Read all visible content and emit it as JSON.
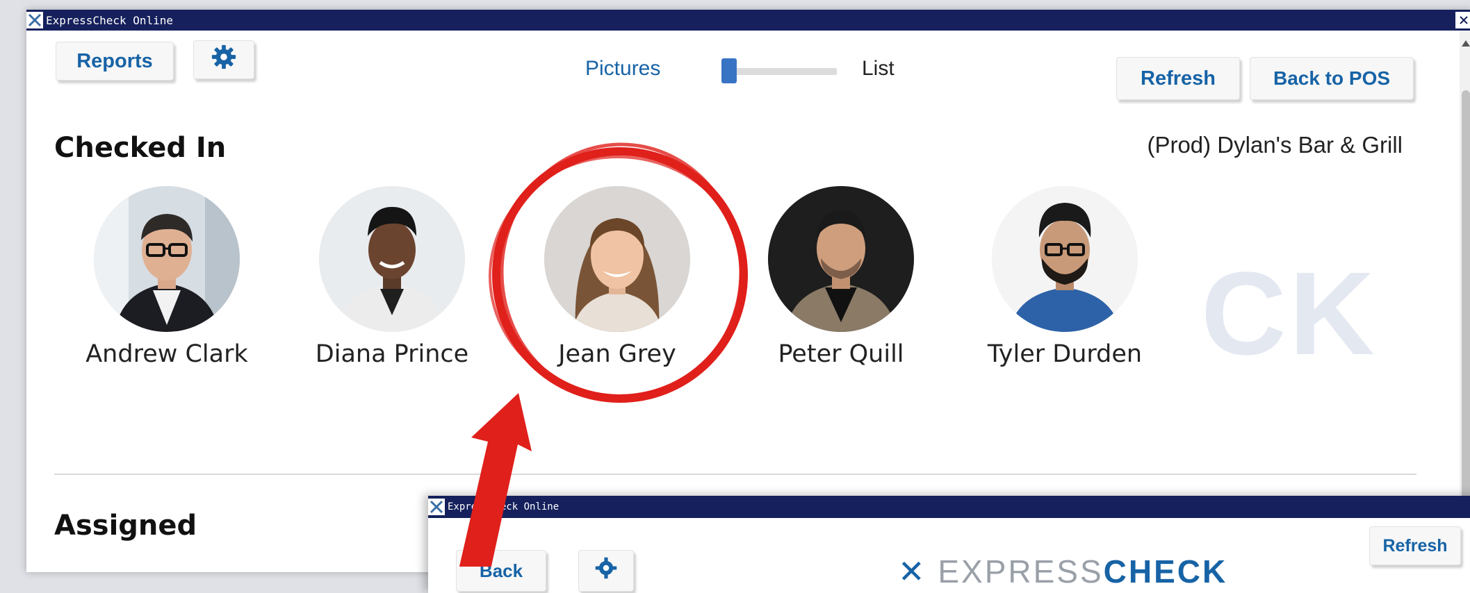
{
  "window": {
    "title": "ExpressCheck Online"
  },
  "toolbar": {
    "reports_label": "Reports",
    "settings_icon": "gear-icon",
    "view_toggle": {
      "left_label": "Pictures",
      "right_label": "List",
      "selected": "Pictures"
    },
    "refresh_label": "Refresh",
    "back_to_pos_label": "Back to POS"
  },
  "venue": "(Prod) Dylan's Bar & Grill",
  "watermark": "CK",
  "sections": {
    "checked_in": {
      "title": "Checked In",
      "people": [
        {
          "name": "Andrew Clark"
        },
        {
          "name": "Diana Prince"
        },
        {
          "name": "Jean Grey"
        },
        {
          "name": "Peter Quill"
        },
        {
          "name": "Tyler Durden"
        }
      ]
    },
    "assigned": {
      "title": "Assigned"
    }
  },
  "annotation": {
    "highlighted": "Jean Grey",
    "color": "#e0201b"
  },
  "overlay_window": {
    "title": "ExpressCheck Online",
    "back_label": "Back",
    "settings_icon": "gear-icon",
    "brand_light": "EXPRESS",
    "brand_bold": "CHECK",
    "refresh_label": "Refresh"
  },
  "colors": {
    "titlebar": "#15205c",
    "accent": "#1763a6",
    "slider": "#3973c4"
  }
}
